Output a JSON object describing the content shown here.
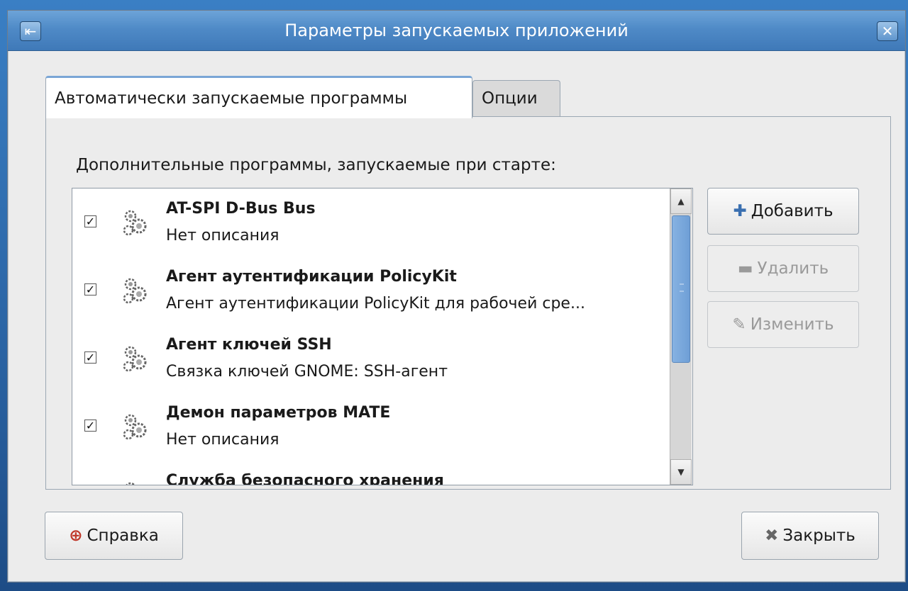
{
  "window": {
    "title": "Параметры запускаемых приложений",
    "menu_icon": "window-menu-icon",
    "close_icon": "close-icon",
    "close_glyph": "✕"
  },
  "tabs": [
    {
      "label": "Автоматически запускаемые программы",
      "active": true
    },
    {
      "label": "Опции",
      "active": false
    }
  ],
  "panel": {
    "label": "Дополнительные программы, запускаемые при старте:"
  },
  "list": {
    "items": [
      {
        "name": "AT-SPI D-Bus Bus",
        "description": "Нет описания",
        "checked": true,
        "icon": "gear-icon"
      },
      {
        "name": "Агент аутентификации PolicyKit",
        "description": "Агент аутентификации PolicyKit для рабочей сре...",
        "checked": true,
        "icon": "gear-icon"
      },
      {
        "name": "Агент ключей SSH",
        "description": "Связка ключей GNOME: SSH-агент",
        "checked": true,
        "icon": "gear-icon"
      },
      {
        "name": "Демон параметров MATE",
        "description": "Нет описания",
        "checked": true,
        "icon": "gear-icon"
      },
      {
        "name": "Служба безопасного хранения",
        "description": "",
        "checked": true,
        "icon": "gear-icon"
      }
    ],
    "check_glyph": "✓"
  },
  "buttons": {
    "add": {
      "label": "Добавить",
      "icon": "plus-icon",
      "glyph": "✚"
    },
    "remove": {
      "label": "Удалить",
      "icon": "minus-icon",
      "glyph": "▬"
    },
    "edit": {
      "label": "Изменить",
      "icon": "edit-icon",
      "glyph": "✎"
    },
    "help": {
      "label": "Справка",
      "icon": "help-icon",
      "glyph": "⊕"
    },
    "close": {
      "label": "Закрыть",
      "icon": "close-x-icon",
      "glyph": "✖"
    }
  }
}
